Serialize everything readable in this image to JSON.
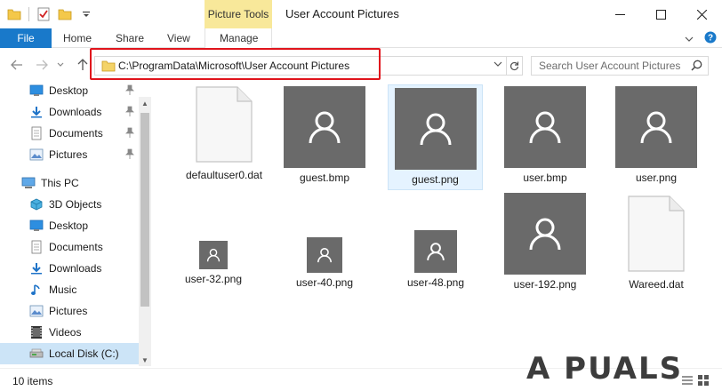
{
  "window": {
    "title": "User Account Pictures",
    "contextual_tab_group": "Picture Tools",
    "controls": [
      "minimize-icon",
      "maximize-icon",
      "close-icon"
    ]
  },
  "ribbon": {
    "tabs": [
      {
        "label": "File",
        "active": false
      },
      {
        "label": "Home"
      },
      {
        "label": "Share"
      },
      {
        "label": "View"
      },
      {
        "label": "Manage"
      }
    ]
  },
  "nav": {
    "address": "C:\\ProgramData\\Microsoft\\User Account Pictures",
    "search_placeholder": "Search User Account Pictures"
  },
  "sidebar": {
    "items": [
      {
        "label": "Desktop",
        "icon": "desktop-icon",
        "pinned": true
      },
      {
        "label": "Downloads",
        "icon": "downloads-icon",
        "pinned": true
      },
      {
        "label": "Documents",
        "icon": "documents-icon",
        "pinned": true
      },
      {
        "label": "Pictures",
        "icon": "pictures-icon",
        "pinned": true
      },
      {
        "label": "This PC",
        "icon": "this-pc-icon"
      },
      {
        "label": "3D Objects",
        "icon": "3d-objects-icon"
      },
      {
        "label": "Desktop",
        "icon": "desktop-icon"
      },
      {
        "label": "Documents",
        "icon": "documents-icon"
      },
      {
        "label": "Downloads",
        "icon": "downloads-icon"
      },
      {
        "label": "Music",
        "icon": "music-icon"
      },
      {
        "label": "Pictures",
        "icon": "pictures-icon"
      },
      {
        "label": "Videos",
        "icon": "videos-icon"
      },
      {
        "label": "Local Disk (C:)",
        "icon": "local-disk-icon",
        "selected": true
      }
    ]
  },
  "files": [
    {
      "name": "defaultuser0.dat",
      "kind": "document"
    },
    {
      "name": "guest.bmp",
      "kind": "picture"
    },
    {
      "name": "guest.png",
      "kind": "picture",
      "selected": true
    },
    {
      "name": "user.bmp",
      "kind": "picture"
    },
    {
      "name": "user.png",
      "kind": "picture"
    },
    {
      "name": "user-32.png",
      "kind": "picture"
    },
    {
      "name": "user-40.png",
      "kind": "picture"
    },
    {
      "name": "user-48.png",
      "kind": "picture"
    },
    {
      "name": "user-192.png",
      "kind": "picture"
    },
    {
      "name": "Wareed.dat",
      "kind": "document"
    }
  ],
  "status": {
    "item_count": "10 items"
  },
  "watermark": "A PUALS",
  "colors": {
    "accent": "#1979ca",
    "contextual_tab": "#f8e89a",
    "thumbnail": "#6a6a6a",
    "highlight": "#e0141c",
    "selection": "#cce4f7"
  }
}
